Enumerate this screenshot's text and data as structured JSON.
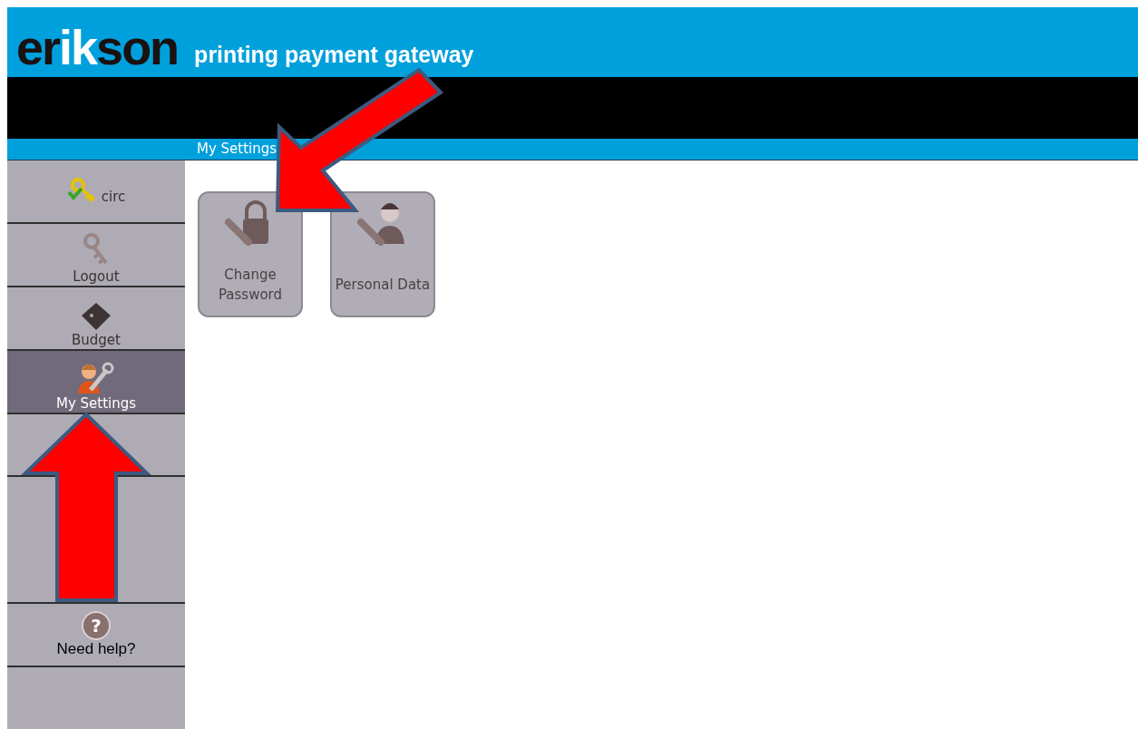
{
  "header": {
    "logo": [
      {
        "text": "er",
        "highlight": false
      },
      {
        "text": "ik",
        "highlight": true
      },
      {
        "text": "son",
        "highlight": false
      }
    ],
    "tagline": "printing payment gateway"
  },
  "breadcrumb": "My Settings",
  "sidebar": {
    "items": [
      {
        "kind": "user",
        "label": "circ",
        "selected": false
      },
      {
        "kind": "logout",
        "label": "Logout",
        "selected": false
      },
      {
        "kind": "budget",
        "label": "Budget",
        "selected": false
      },
      {
        "kind": "settings",
        "label": "My Settings",
        "selected": true
      }
    ],
    "help": {
      "icon": "?",
      "label": "Need help?"
    }
  },
  "tiles": [
    {
      "kind": "password",
      "label": "Change Password"
    },
    {
      "kind": "person",
      "label": "Personal Data"
    }
  ]
}
